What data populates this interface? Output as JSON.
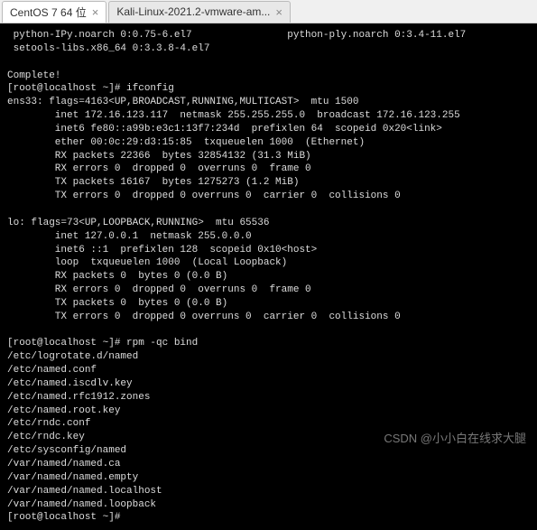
{
  "tabs": [
    {
      "label": "CentOS 7 64 位",
      "active": true
    },
    {
      "label": "Kali-Linux-2021.2-vmware-am...",
      "active": false
    }
  ],
  "terminal_lines": [
    " python-IPy.noarch 0:0.75-6.el7                python-ply.noarch 0:3.4-11.el7",
    " setools-libs.x86_64 0:3.3.8-4.el7",
    "",
    "Complete!",
    "[root@localhost ~]# ifconfig",
    "ens33: flags=4163<UP,BROADCAST,RUNNING,MULTICAST>  mtu 1500",
    "        inet 172.16.123.117  netmask 255.255.255.0  broadcast 172.16.123.255",
    "        inet6 fe80::a99b:e3c1:13f7:234d  prefixlen 64  scopeid 0x20<link>",
    "        ether 00:0c:29:d3:15:85  txqueuelen 1000  (Ethernet)",
    "        RX packets 22366  bytes 32854132 (31.3 MiB)",
    "        RX errors 0  dropped 0  overruns 0  frame 0",
    "        TX packets 16167  bytes 1275273 (1.2 MiB)",
    "        TX errors 0  dropped 0 overruns 0  carrier 0  collisions 0",
    "",
    "lo: flags=73<UP,LOOPBACK,RUNNING>  mtu 65536",
    "        inet 127.0.0.1  netmask 255.0.0.0",
    "        inet6 ::1  prefixlen 128  scopeid 0x10<host>",
    "        loop  txqueuelen 1000  (Local Loopback)",
    "        RX packets 0  bytes 0 (0.0 B)",
    "        RX errors 0  dropped 0  overruns 0  frame 0",
    "        TX packets 0  bytes 0 (0.0 B)",
    "        TX errors 0  dropped 0 overruns 0  carrier 0  collisions 0",
    "",
    "[root@localhost ~]# rpm -qc bind",
    "/etc/logrotate.d/named",
    "/etc/named.conf",
    "/etc/named.iscdlv.key",
    "/etc/named.rfc1912.zones",
    "/etc/named.root.key",
    "/etc/rndc.conf",
    "/etc/rndc.key",
    "/etc/sysconfig/named",
    "/var/named/named.ca",
    "/var/named/named.empty",
    "/var/named/named.localhost",
    "/var/named/named.loopback",
    "[root@localhost ~]# "
  ],
  "watermark": "CSDN @小小白在线求大腿"
}
